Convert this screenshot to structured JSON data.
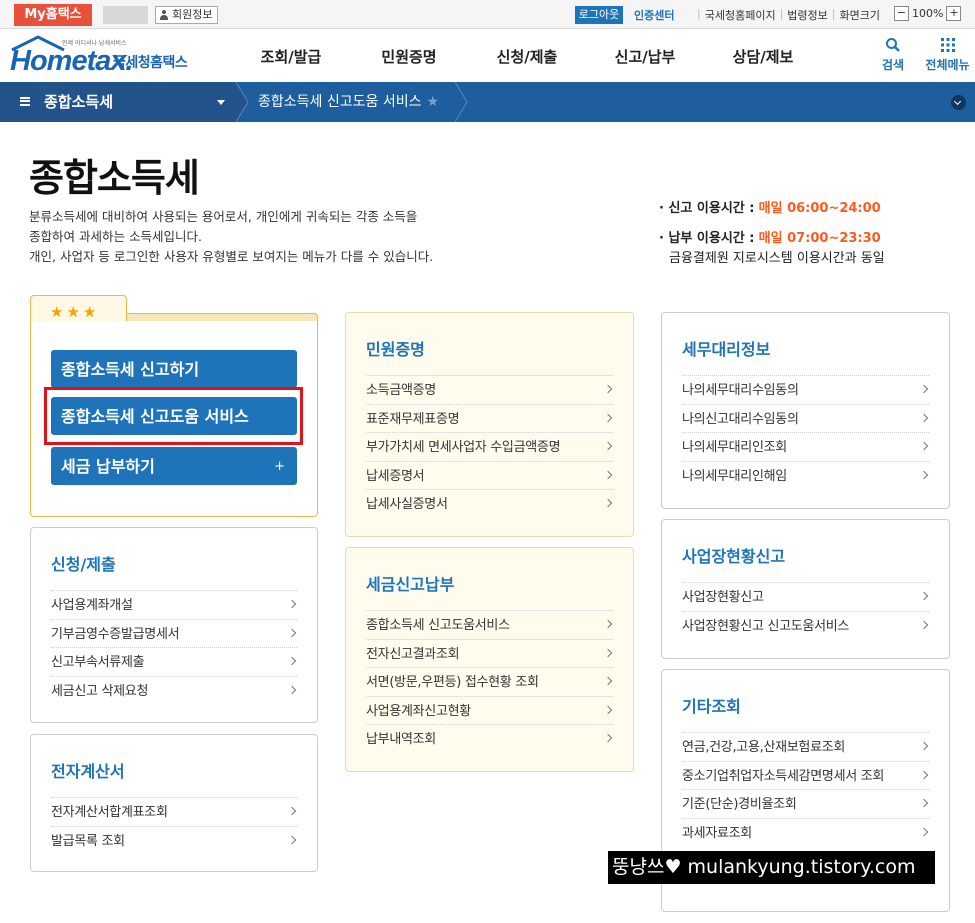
{
  "topbar": {
    "my_hometax": "My홈택스",
    "member_info": "회원정보",
    "logout": "로그아웃",
    "cert_center": "인증센터",
    "links": [
      "국세청홈페이지",
      "법령정보",
      "화면크기"
    ],
    "zoom_minus": "−",
    "zoom_value": "100%",
    "zoom_plus": "+"
  },
  "header": {
    "logo_text": "Hometax.",
    "logo_ko": "국세청홈택스",
    "logo_sub": "언제 어디서나 납세서비스",
    "nav": [
      "조회/발급",
      "민원증명",
      "신청/제출",
      "신고/납부",
      "상담/제보"
    ],
    "search_label": "검색",
    "menu_label": "전체메뉴"
  },
  "location": {
    "section": "종합소득세",
    "current": "종합소득세 신고도움 서비스",
    "star": "★"
  },
  "page": {
    "title": "종합소득세",
    "desc": [
      "분류소득세에 대비하여 사용되는 용어로서, 개인에게 귀속되는 각종 소득을",
      "종합하여 과세하는 소득세입니다.",
      "개인, 사업자 등 로그인한 사용자 유형별로 보여지는 메뉴가 다를 수 있습니다."
    ],
    "report_time_label": "· 신고 이용시간 :",
    "report_time_value": "매일 06:00~24:00",
    "pay_time_label": "· 납부 이용시간 :",
    "pay_time_value": "매일 07:00~23:30",
    "pay_time_note": "금융결제원 지로시스템 이용시간과 동일"
  },
  "favorites": {
    "stars": "★★★",
    "buttons": [
      "종합소득세 신고하기",
      "종합소득세 신고도움 서비스",
      "세금 납부하기"
    ],
    "plus": "+"
  },
  "cards": {
    "apply": {
      "title": "신청/제출",
      "items": [
        "사업용계좌개설",
        "기부금영수증발급명세서",
        "신고부속서류제출",
        "세금신고 삭제요청"
      ]
    },
    "invoice": {
      "title": "전자계산서",
      "items": [
        "전자계산서합계표조회",
        "발급목록 조회"
      ]
    },
    "civil": {
      "title": "민원증명",
      "items": [
        "소득금액증명",
        "표준재무제표증명",
        "부가가치세 면세사업자 수입금액증명",
        "납세증명서",
        "납세사실증명서"
      ]
    },
    "taxreport": {
      "title": "세금신고납부",
      "items": [
        "종합소득세 신고도움서비스",
        "전자신고결과조회",
        "서면(방문,우편등) 접수현황 조회",
        "사업용계좌신고현황",
        "납부내역조회"
      ]
    },
    "agent": {
      "title": "세무대리정보",
      "items": [
        "나의세무대리수임동의",
        "나의신고대리수임동의",
        "나의세무대리인조회",
        "나의세무대리인해임"
      ]
    },
    "business": {
      "title": "사업장현황신고",
      "items": [
        "사업장현황신고",
        "사업장현황신고 신고도움서비스"
      ]
    },
    "etc": {
      "title": "기타조회",
      "items": [
        "연금,건강,고용,산재보험료조회",
        "중소기업취업자소득세감면명세서 조회",
        "기준(단순)경비율조회",
        "과세자료조회"
      ]
    }
  },
  "watermark": "뚱냥쓰♥ mulankyung.tistory.com",
  "colors": {
    "primary": "#1f74b9",
    "accent": "#e8503a",
    "highlight": "#e0131a",
    "orange": "#ff5a1f"
  }
}
